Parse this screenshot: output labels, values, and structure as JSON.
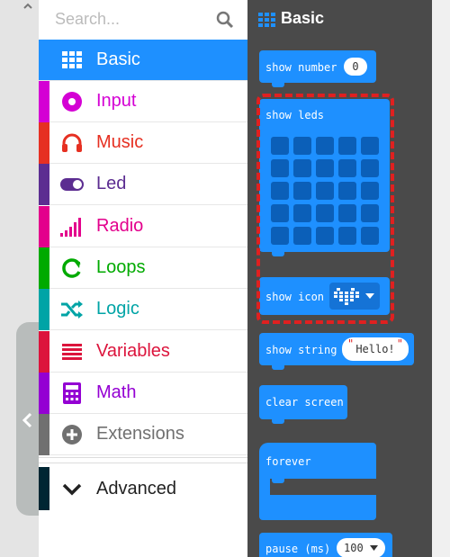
{
  "search": {
    "placeholder": "Search..."
  },
  "categories": [
    {
      "label": "Basic",
      "color": "#1e90ff",
      "icon": "grid-icon",
      "selected": true
    },
    {
      "label": "Input",
      "color": "#d400d4",
      "icon": "target-icon"
    },
    {
      "label": "Music",
      "color": "#e63022",
      "icon": "headphones-icon"
    },
    {
      "label": "Led",
      "color": "#5c2d91",
      "icon": "toggle-icon"
    },
    {
      "label": "Radio",
      "color": "#e3008c",
      "icon": "signal-bars-icon"
    },
    {
      "label": "Loops",
      "color": "#00aa00",
      "icon": "loop-arrow-icon"
    },
    {
      "label": "Logic",
      "color": "#00a4a6",
      "icon": "shuffle-icon"
    },
    {
      "label": "Variables",
      "color": "#dc143c",
      "icon": "list-lines-icon"
    },
    {
      "label": "Math",
      "color": "#9400d3",
      "icon": "calculator-icon"
    },
    {
      "label": "Extensions",
      "color": "#707070",
      "icon": "plus-circle-icon"
    }
  ],
  "advanced": {
    "label": "Advanced",
    "color": "#002633",
    "icon": "chevron-down-icon"
  },
  "flyout": {
    "title": "Basic",
    "blocks": {
      "show_number": {
        "label": "show number",
        "value": "0"
      },
      "show_leds": {
        "label": "show leds"
      },
      "show_icon": {
        "label": "show icon"
      },
      "show_string": {
        "label": "show string",
        "value": "Hello!"
      },
      "clear_screen": {
        "label": "clear screen"
      },
      "forever": {
        "label": "forever"
      },
      "pause": {
        "label": "pause (ms)",
        "value": "100"
      }
    }
  },
  "colors": {
    "block_blue": "#1e90ff",
    "highlight_red": "#e02020",
    "flyout_bg": "#4a4a4a"
  }
}
